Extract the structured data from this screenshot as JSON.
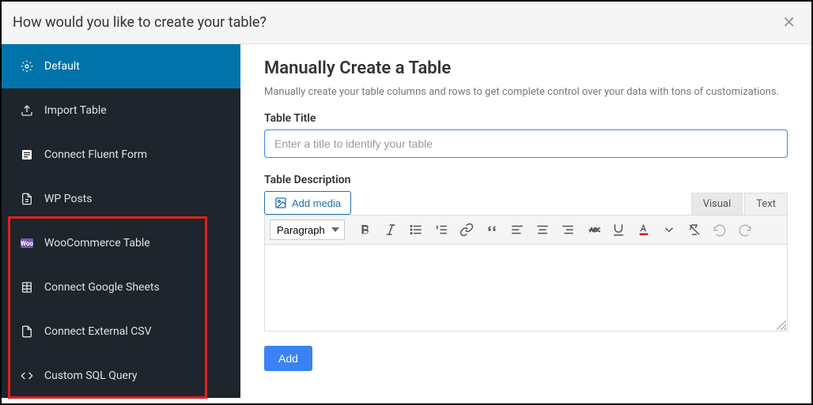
{
  "modal": {
    "title": "How would you like to create your table?"
  },
  "sidebar": {
    "items": [
      {
        "label": "Default",
        "active": true
      },
      {
        "label": "Import Table"
      },
      {
        "label": "Connect Fluent Form"
      },
      {
        "label": "WP Posts"
      },
      {
        "label": "WooCommerce Table"
      },
      {
        "label": "Connect Google Sheets"
      },
      {
        "label": "Connect External CSV"
      },
      {
        "label": "Custom SQL Query"
      }
    ]
  },
  "main": {
    "heading": "Manually Create a Table",
    "subtitle": "Manually create your table columns and rows to get complete control over your data with tons of customizations.",
    "table_title_label": "Table Title",
    "table_title_placeholder": "Enter a title to identify your table",
    "table_title_value": "",
    "description_label": "Table Description",
    "add_media_label": "Add media",
    "tabs": {
      "visual": "Visual",
      "text": "Text"
    },
    "paragraph_label": "Paragraph",
    "toolbar_buttons": [
      "bold",
      "italic",
      "bullet-list",
      "number-list",
      "link",
      "quote",
      "align-left",
      "align-center",
      "align-right",
      "strikethrough",
      "underline",
      "text-color",
      "eraser",
      "undo",
      "redo"
    ],
    "editor_content": "",
    "add_button": "Add"
  }
}
